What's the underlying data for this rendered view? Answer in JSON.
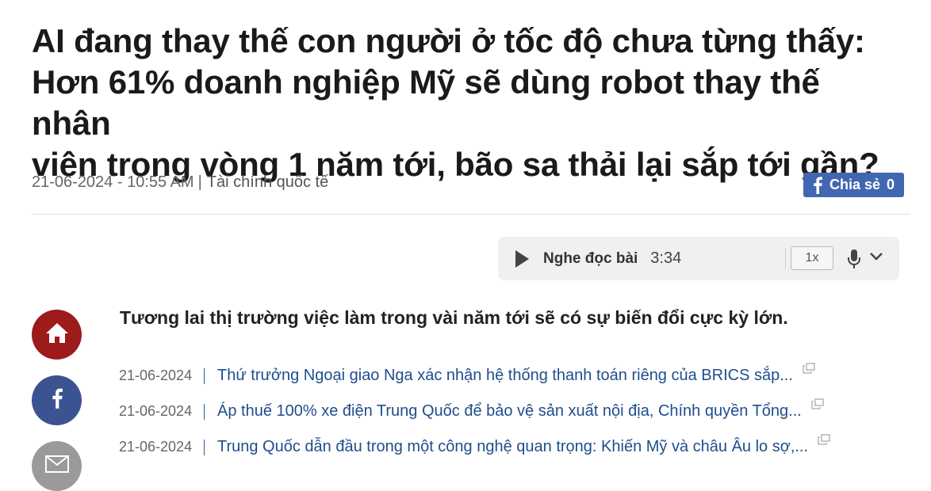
{
  "article": {
    "title_lines": [
      "AI đang thay thế con người ở tốc độ chưa từng thấy:",
      "Hơn 61% doanh nghiệp Mỹ sẽ dùng robot thay thế nhân",
      "viên trong vòng 1 năm tới, bão sa thải lại sắp tới gần?"
    ],
    "datetime": "21-06-2024 - 10:55 AM",
    "separator": "|",
    "category": "Tài chính quốc tế",
    "lead": "Tương lai thị trường việc làm trong vài năm tới sẽ có sự biến đổi cực kỳ lớn."
  },
  "share": {
    "label": "Chia sẻ",
    "count": "0",
    "color": "#4267b2"
  },
  "audio": {
    "label": "Nghe đọc bài",
    "duration": "3:34",
    "speed": "1x"
  },
  "social": [
    {
      "icon": "home-icon",
      "color": "#9e1b1b"
    },
    {
      "icon": "facebook-icon",
      "color": "#3b5390"
    },
    {
      "icon": "mail-icon",
      "color": "#9a9a9a"
    }
  ],
  "related": [
    {
      "date": "21-06-2024",
      "title": "Thứ trưởng Ngoại giao Nga xác nhận hệ thống thanh toán riêng của BRICS sắp..."
    },
    {
      "date": "21-06-2024",
      "title": "Áp thuế 100% xe điện Trung Quốc để bảo vệ sản xuất nội địa, Chính quyền Tổng..."
    },
    {
      "date": "21-06-2024",
      "title": "Trung Quốc dẫn đầu trong một công nghệ quan trọng: Khiến Mỹ và châu Âu lo sợ,..."
    }
  ],
  "colors": {
    "link": "#1f4e8c",
    "accent_red": "#9e1b1b"
  }
}
